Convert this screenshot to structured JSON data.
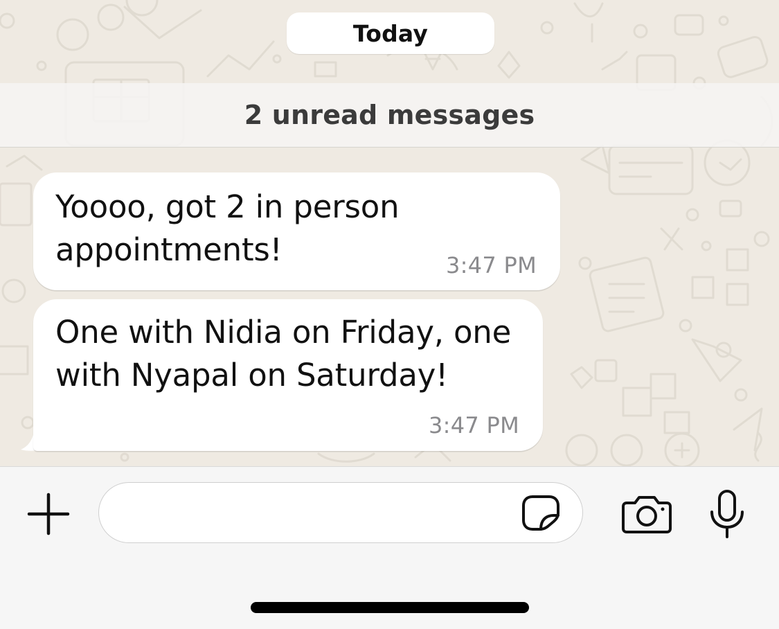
{
  "chat": {
    "date_divider": "Today",
    "unread_banner": "2 unread messages",
    "messages": [
      {
        "text": "Yoooo, got 2 in person\nappointments!",
        "time": "3:47 PM"
      },
      {
        "text": "One with Nidia on Friday, one\nwith Nyapal on Saturday!",
        "time": "3:47 PM"
      }
    ]
  },
  "composer": {
    "input_value": "",
    "icons": {
      "add": "plus-icon",
      "sticker": "sticker-icon",
      "camera": "camera-icon",
      "microphone": "microphone-icon"
    }
  },
  "colors": {
    "wallpaper": "#efeae2",
    "bubble": "#ffffff",
    "composer_background": "#f6f6f6",
    "timestamp": "#8a8a8d"
  }
}
